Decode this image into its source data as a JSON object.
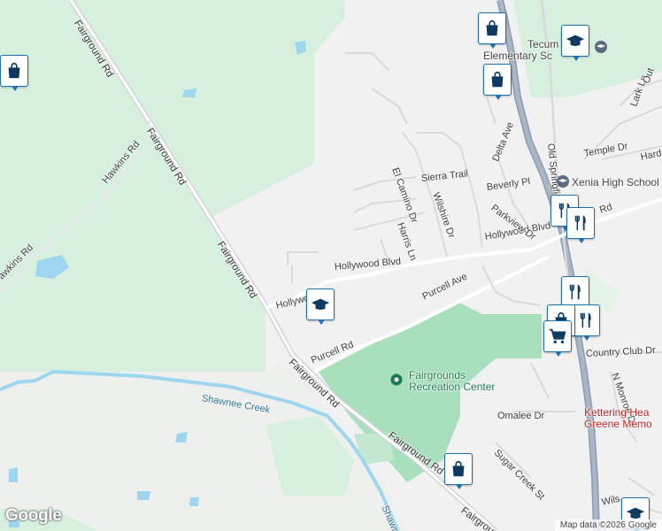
{
  "map": {
    "colors": {
      "land": "#f2f1f2",
      "park": "#d6f0dd",
      "park_dark": "#a8dfbc",
      "water": "#9fd6ef",
      "highway": "#8c9cb0",
      "road": "#ffffff",
      "minor_road": "#d9d9de",
      "marker_border": "#1f6fb5",
      "marker_icon": "#0e3a5f"
    },
    "roads": {
      "fairground_rd_1": "Fairground Rd",
      "fairground_rd_2": "Fairground Rd",
      "fairground_rd_3": "Fairground Rd",
      "fairground_rd_4": "Fairground Rd",
      "fairground_rd_5": "Fairground Rd",
      "fairground_rd_6": "Fairground Rd",
      "hawkins_rd_1": "Hawkins Rd",
      "hawkins_rd_2": "awkins Rd",
      "hollywood_blvd_1": "Hollywood Blvd",
      "hollywood_blvd_2": "Hollywood Blvd",
      "hollywood_blvd_3": "Hollywo",
      "purcell_ave": "Purcell Ave",
      "purcell_rd": "Purcell Rd",
      "el_camino_dr": "El Camino Dr",
      "sierra_trail": "Sierra Trail",
      "wilshire_dr": "Wilshire Dr",
      "harris_ln": "Harris Ln",
      "delta_ave": "Delta Ave",
      "beverly_pl": "Beverly Pl",
      "parkview_dr": "Parkview Dr",
      "old_springfield": "Old Springfiel",
      "temple_dr": "Temple Dr",
      "lark_ln": "Lark Ln",
      "hard": "Hard",
      "out": "Out",
      "rd_near_school": "Rd",
      "country_club_dr": "Country Club Dr",
      "n_monroe_dr": "N Monroe Dr",
      "omalee_dr": "Omalee Dr",
      "sugar_creek_st": "Sugar Creek St",
      "wils": "Wils",
      "shawnee_creek": "Shawnee Creek",
      "shawnee_2": "Shawne"
    },
    "places": {
      "fairgrounds_line1": "Fairgrounds",
      "fairgrounds_line2": "Recreation Center",
      "xenia_high": "Xenia High School",
      "tecum_line1": "Tecum",
      "tecum_line2": "Elementary Sc",
      "kettering_line1": "Kettering Hea",
      "kettering_line2": "Greene Memo"
    },
    "markers": [
      {
        "name": "shopping-marker-1",
        "icon": "shopping-bag-icon"
      },
      {
        "name": "shopping-marker-2",
        "icon": "shopping-bag-icon"
      },
      {
        "name": "shopping-marker-3",
        "icon": "shopping-bag-icon"
      },
      {
        "name": "school-marker-1",
        "icon": "graduation-cap-icon"
      },
      {
        "name": "restaurant-marker-1",
        "icon": "fork-knife-icon"
      },
      {
        "name": "restaurant-marker-2",
        "icon": "fork-knife-icon"
      },
      {
        "name": "restaurant-marker-3",
        "icon": "fork-knife-icon"
      },
      {
        "name": "restaurant-marker-4",
        "icon": "fork-knife-icon"
      },
      {
        "name": "shopping-marker-4",
        "icon": "shopping-bag-icon"
      },
      {
        "name": "cart-marker-1",
        "icon": "shopping-cart-icon"
      },
      {
        "name": "school-marker-2",
        "icon": "graduation-cap-icon"
      },
      {
        "name": "shopping-marker-5",
        "icon": "shopping-bag-icon"
      },
      {
        "name": "school-marker-3",
        "icon": "graduation-cap-icon"
      }
    ],
    "footer": {
      "logo": "Google",
      "attribution": "Map data ©2026 Google"
    }
  }
}
